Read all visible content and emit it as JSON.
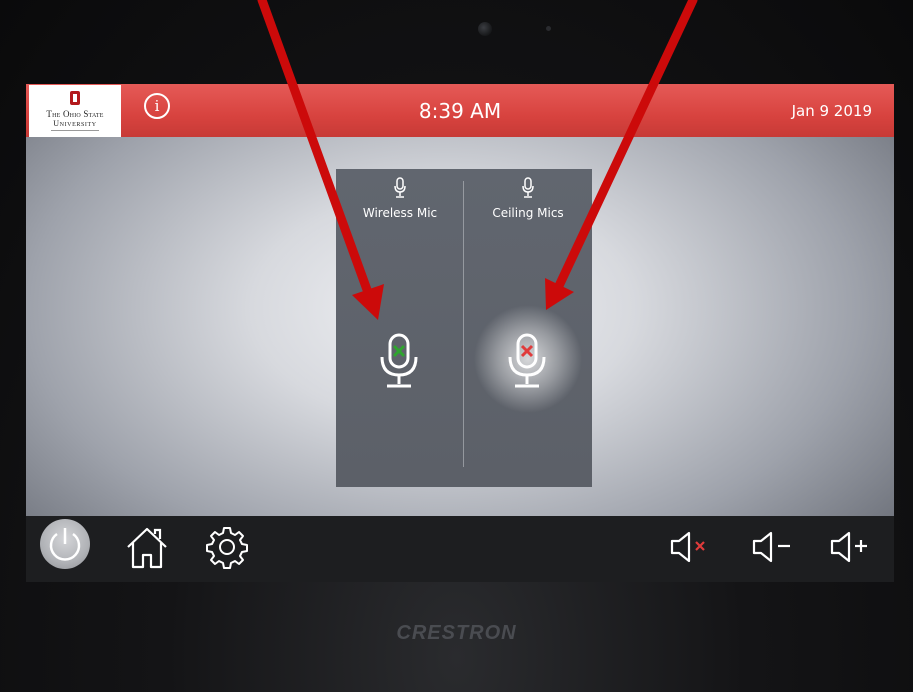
{
  "header": {
    "logo_line1": "The Ohio State",
    "logo_line2": "University",
    "info_glyph": "i",
    "time": "8:39 AM",
    "date": "Jan 9 2019"
  },
  "mics": [
    {
      "label": "Wireless Mic",
      "status": "unmuted",
      "status_color": "#2fa52f"
    },
    {
      "label": "Ceiling Mics",
      "status": "muted",
      "status_color": "#e03b3b",
      "selected": true
    }
  ],
  "toolbar": {
    "power": "power-icon",
    "home": "home-icon",
    "settings": "gear-icon",
    "mute": "volume-mute-icon",
    "volume_down": "volume-down-icon",
    "volume_up": "volume-up-icon"
  },
  "brand": "CRESTRON",
  "colors": {
    "header": "#d8433f",
    "annotation_arrow": "#cc0a0a",
    "panel": "#5e626a",
    "toolbar": "#1d1e20"
  }
}
